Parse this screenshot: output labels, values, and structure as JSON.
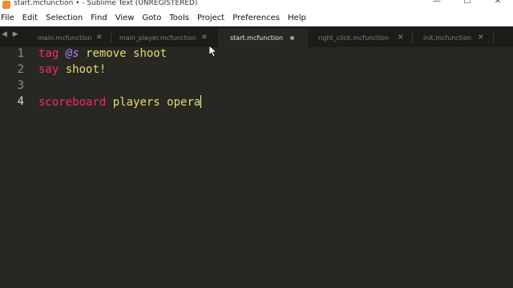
{
  "window": {
    "title": "start.mcfunction • - Sublime Text (UNREGISTERED)",
    "controls": {
      "minimize": "—",
      "maximize": "☐",
      "close": "✕"
    }
  },
  "menubar": {
    "items": [
      "File",
      "Edit",
      "Selection",
      "Find",
      "View",
      "Goto",
      "Tools",
      "Project",
      "Preferences",
      "Help"
    ]
  },
  "tabs": {
    "nav": "◀ ▶",
    "items": [
      {
        "label": "main.mcfunction",
        "close": "✕"
      },
      {
        "label": "main_player.mcfunction",
        "close": "✕"
      },
      {
        "label": "start.mcfunction",
        "dirty": true
      },
      {
        "label": "right_click.mcfunction",
        "close": "✕"
      },
      {
        "label": "init.mcfunction",
        "close": "✕"
      }
    ]
  },
  "editor": {
    "line_numbers": [
      "1",
      "2",
      "3",
      "4"
    ],
    "current_line": "4",
    "lines": [
      {
        "tokens": [
          "tag",
          " ",
          "@s",
          " remove shoot"
        ]
      },
      {
        "tokens": [
          "say",
          " shoot!"
        ]
      },
      {
        "tokens": []
      },
      {
        "tokens": [
          "scoreboard",
          " players opera"
        ]
      }
    ]
  },
  "colors": {
    "background": "#272822",
    "keyword": "#f92672",
    "string": "#e6db74",
    "selector": "#ae81ff",
    "tab_bar": "#1c1d19"
  }
}
